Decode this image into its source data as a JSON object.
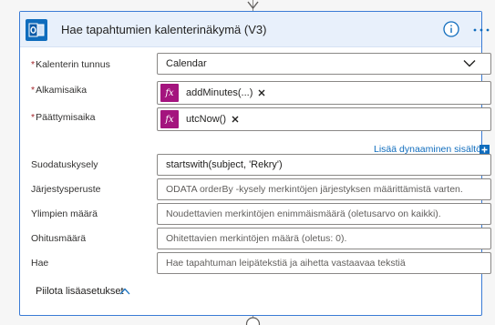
{
  "card": {
    "title": "Hae tapahtumien kalenterinäkymä (V3)",
    "accent_color": "#3a7bd5",
    "header_bg": "#e8f0fb",
    "icons": {
      "app": "outlook-icon",
      "info": "info-icon",
      "more": "more-options-icon"
    }
  },
  "fields": {
    "calendar": {
      "label": "Kalenterin tunnus",
      "required": "*",
      "value": "Calendar",
      "icon": "chevron-down-icon"
    },
    "start": {
      "label": "Alkamisaika",
      "required": "*",
      "token": {
        "symbol": "fx",
        "text": "addMinutes(...)",
        "color": "#a4147e"
      }
    },
    "end": {
      "label": "Päättymisaika",
      "required": "*",
      "token": {
        "symbol": "fx",
        "text": "utcNow()",
        "color": "#a4147e"
      }
    },
    "dynamic_content_link": "Lisää dynaaminen sisältö",
    "filter": {
      "label": "Suodatuskysely",
      "value": "startswith(subject, 'Rekry')"
    },
    "order": {
      "label": "Järjestysperuste",
      "placeholder": "ODATA orderBy -kysely merkintöjen järjestyksen määrittämistä varten."
    },
    "top": {
      "label": "Ylimpien määrä",
      "placeholder": "Noudettavien merkintöjen enimmäismäärä (oletusarvo on kaikki)."
    },
    "skip": {
      "label": "Ohitusmäärä",
      "placeholder": "Ohitettavien merkintöjen määrä (oletus: 0)."
    },
    "search": {
      "label": "Hae",
      "placeholder": "Hae tapahtuman leipätekstiä ja aihetta vastaavaa tekstiä"
    }
  },
  "advanced_toggle": {
    "label": "Piilota lisäasetukset",
    "icon": "chevron-up-icon"
  }
}
